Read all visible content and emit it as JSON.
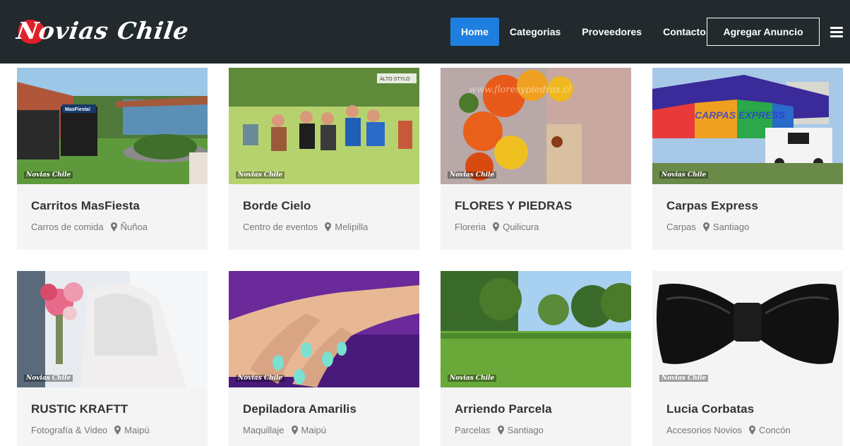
{
  "brand": {
    "logo_text": "Novias Chile",
    "accent": "#e0202a"
  },
  "nav": {
    "items": [
      {
        "label": "Home",
        "active": true
      },
      {
        "label": "Categorias",
        "active": false
      },
      {
        "label": "Proveedores",
        "active": false
      },
      {
        "label": "Contacto",
        "active": false
      }
    ],
    "cta_label": "Agregar Anuncio",
    "menu_icon": "hamburger-icon"
  },
  "colors": {
    "header_bg": "#222a2e",
    "active_nav": "#1f7fe0",
    "card_bg": "#f4f4f4"
  },
  "listings": [
    {
      "title": "Carritos MasFiesta",
      "category": "Carros de comida",
      "location": "Ñuñoa",
      "watermark": "Novias Chile",
      "sign_text": "MasFiesta!"
    },
    {
      "title": "Borde Cielo",
      "category": "Centro de eventos",
      "location": "Melipilla",
      "watermark": "Novias Chile",
      "sign_text": "ALTO STYLO"
    },
    {
      "title": "FLORES Y PIEDRAS",
      "category": "Floreria",
      "location": "Quilicura",
      "watermark": "Novias Chile",
      "sign_text": "www.floresypiedras.cl"
    },
    {
      "title": "Carpas Express",
      "category": "Carpas",
      "location": "Santiago",
      "watermark": "Novias Chile",
      "sign_text": "CARPAS EXPRESS"
    },
    {
      "title": "RUSTIC KRAFTT",
      "category": "Fotografía & Video",
      "location": "Maipú",
      "watermark": "Novias Chile"
    },
    {
      "title": "Depiladora Amarilis",
      "category": "Maquillaje",
      "location": "Maipú",
      "watermark": "Novias Chile"
    },
    {
      "title": "Arriendo Parcela",
      "category": "Parcelas",
      "location": "Santiago",
      "watermark": "Novias Chile"
    },
    {
      "title": "Lucia Corbatas",
      "category": "Accesorios Novios",
      "location": "Concón",
      "watermark": "Novias Chile"
    }
  ]
}
